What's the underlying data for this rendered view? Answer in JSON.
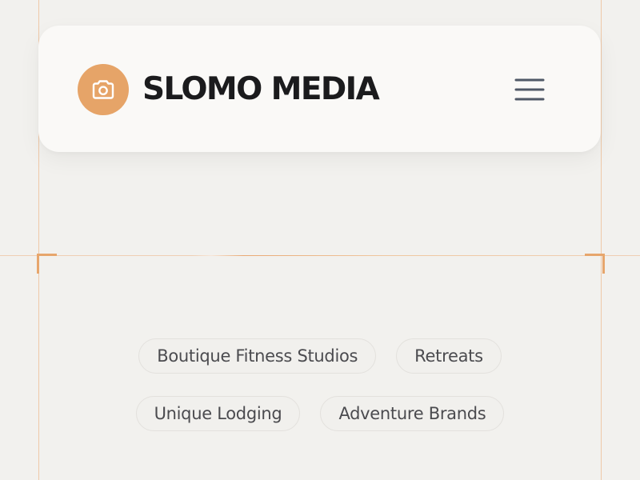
{
  "header": {
    "brand_name": "SLOMO MEDIA",
    "logo_icon": "camera-icon",
    "menu_icon": "hamburger-menu-icon"
  },
  "tags": {
    "row1": [
      "Boutique Fitness Studios",
      "Retreats"
    ],
    "row2": [
      "Unique Lodging",
      "Adventure Brands"
    ]
  },
  "colors": {
    "accent": "#e6a468",
    "background": "#f2f1ee",
    "card": "#faf9f7",
    "brand_text": "#1b1b1d",
    "menu_icon": "#4f5866",
    "guide_line": "#efc9a8"
  }
}
